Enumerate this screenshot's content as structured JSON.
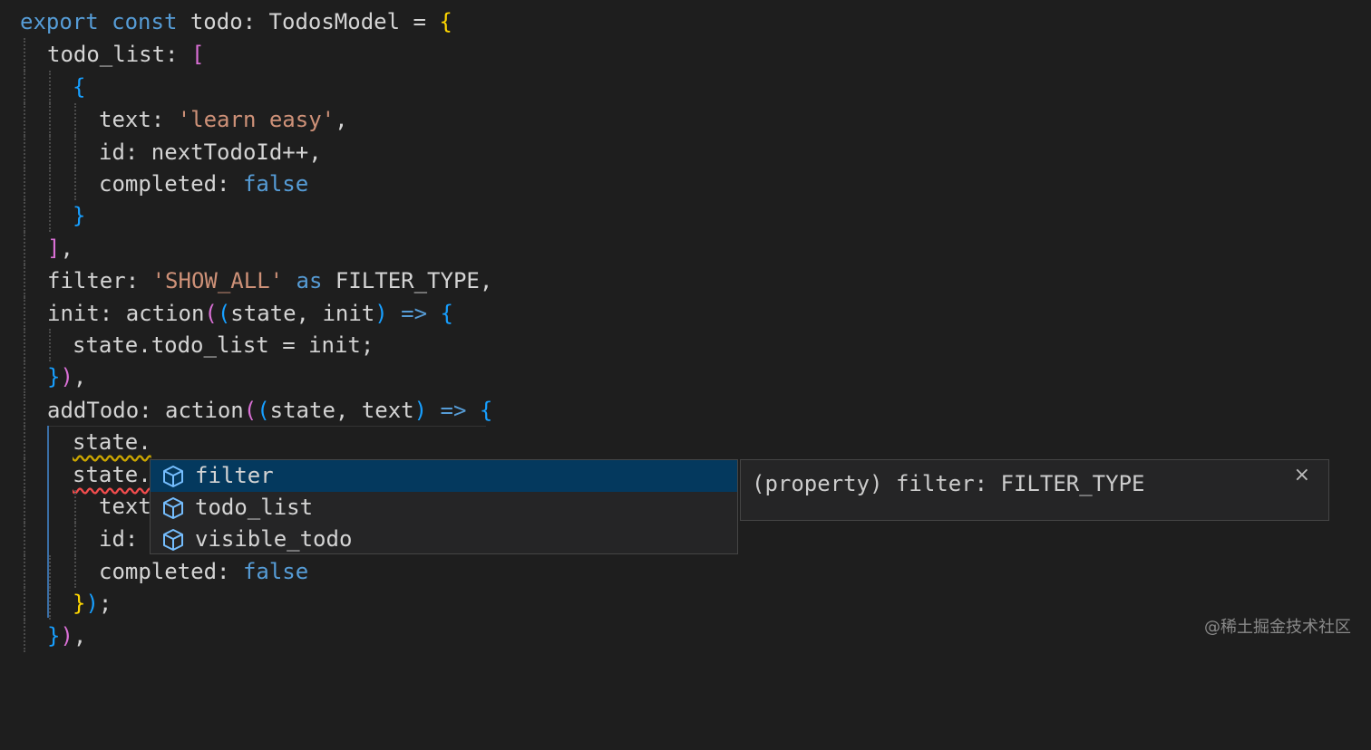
{
  "colors": {
    "keyword": "#569cd6",
    "string": "#ce9178",
    "boolean": "#569cd6",
    "bracket_gold": "#ffd700",
    "bracket_orchid": "#da70d6",
    "bracket_blue": "#179fff",
    "background": "#1e1e1e",
    "selection": "#04395e"
  },
  "code": {
    "line1": {
      "export": "export",
      "const": "const",
      "rest": " todo: TodosModel = ",
      "brace": "{"
    },
    "line2": {
      "key": "todo_list: ",
      "bracket": "["
    },
    "line3": {
      "brace": "{"
    },
    "line4": {
      "key": "text: ",
      "str": "'learn easy'",
      "comma": ","
    },
    "line5": {
      "text": "id: nextTodoId++,"
    },
    "line6": {
      "key": "completed: ",
      "val": "false"
    },
    "line7": {
      "brace": "}"
    },
    "line8": {
      "bracket": "]",
      "comma": ","
    },
    "line9": {
      "key": "filter: ",
      "str": "'SHOW_ALL'",
      "as": "as",
      "rest": " FILTER_TYPE,"
    },
    "line10": {
      "key": "init: action",
      "p1": "(",
      "p2": "(",
      "args": "state, init",
      "p3": ")",
      "arrow": "=>",
      "brace": "{"
    },
    "line11": {
      "text": "state.todo_list = init;"
    },
    "line12": {
      "brace": "}",
      "p": ")",
      "comma": ","
    },
    "line13": {
      "key": "addTodo: action",
      "p1": "(",
      "p2": "(",
      "args": "state, text",
      "p3": ")",
      "arrow": "=>",
      "brace": "{"
    },
    "line14": {
      "text": "state."
    },
    "line15": {
      "text": "state."
    },
    "line16": {
      "text": "text"
    },
    "line17": {
      "text": "id:"
    },
    "line18": {
      "key": "completed: ",
      "val": "false"
    },
    "line19": {
      "brace": "}",
      "p": ")",
      "semi": ";"
    },
    "line20": {
      "brace": "}",
      "p": ")",
      "comma": ","
    }
  },
  "suggest": {
    "items": [
      {
        "label": "filter",
        "icon": "property-cube-icon",
        "selected": true
      },
      {
        "label": "todo_list",
        "icon": "property-cube-icon",
        "selected": false
      },
      {
        "label": "visible_todo",
        "icon": "property-cube-icon",
        "selected": false
      }
    ],
    "details": "(property) filter: FILTER_TYPE",
    "close": "×"
  },
  "watermark": "@稀土掘金技术社区"
}
